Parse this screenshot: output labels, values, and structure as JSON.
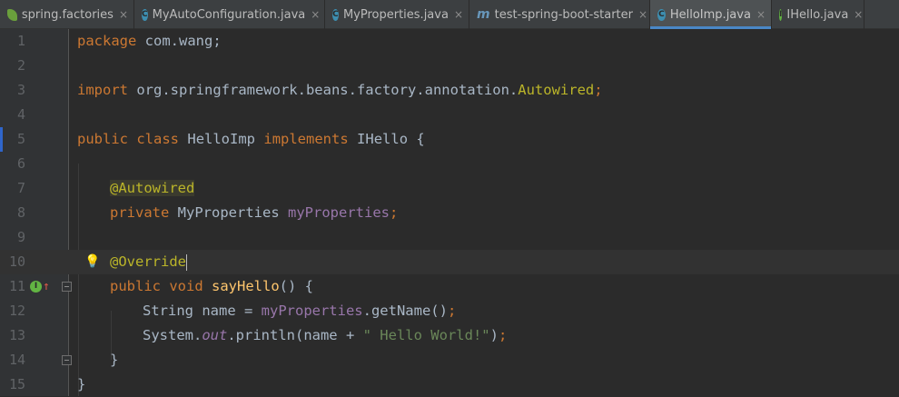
{
  "tabs": [
    {
      "label": "spring.factories",
      "icon": "leaf-icon",
      "active": false
    },
    {
      "label": "MyAutoConfiguration.java",
      "icon": "class-icon",
      "active": false
    },
    {
      "label": "MyProperties.java",
      "icon": "class-icon",
      "active": false
    },
    {
      "label": "test-spring-boot-starter",
      "icon": "module-icon",
      "active": false
    },
    {
      "label": "HelloImp.java",
      "icon": "class-icon",
      "active": true
    },
    {
      "label": "IHello.java",
      "icon": "interface-icon",
      "active": false
    }
  ],
  "close_glyph": "×",
  "icon_letters": {
    "class": "C",
    "interface": "I",
    "module": "m"
  },
  "line_numbers": [
    "1",
    "2",
    "3",
    "4",
    "5",
    "6",
    "7",
    "8",
    "9",
    "10",
    "11",
    "12",
    "13",
    "14",
    "15"
  ],
  "code": {
    "l1_kw": "package",
    "l1_rest": " com.wang;",
    "l3_kw": "import",
    "l3_pkg": " org.springframework.beans.factory.annotation.",
    "l3_ann": "Autowired",
    "l3_semi": ";",
    "l5_kw1": "public",
    "l5_kw2": "class",
    "l5_name": "HelloImp",
    "l5_kw3": "implements",
    "l5_rest": "IHello {",
    "l7_ann": "@Autowired",
    "l8_kw": "private",
    "l8_type": "MyProperties",
    "l8_field": "myProperties",
    "l8_semi": ";",
    "l10_ann": "@Override",
    "l11_kw1": "public",
    "l11_kw2": "void",
    "l11_method": "sayHello",
    "l11_rest": "() {",
    "l12_type": "String name = ",
    "l12_field": "myProperties",
    "l12_rest": ".getName()",
    "l12_semi": ";",
    "l13_a": "System.",
    "l13_static": "out",
    "l13_b": ".println(name + ",
    "l13_str": "\" Hello World!\"",
    "l13_c": ")",
    "l13_semi": ";",
    "l14": "}",
    "l15": "}"
  },
  "colors": {
    "background": "#2b2b2b",
    "keyword": "#cc7832",
    "annotation": "#bbb529",
    "field": "#9876aa",
    "method": "#ffc66d",
    "string": "#6a8759",
    "active_tab_underline": "#4a88c7"
  }
}
